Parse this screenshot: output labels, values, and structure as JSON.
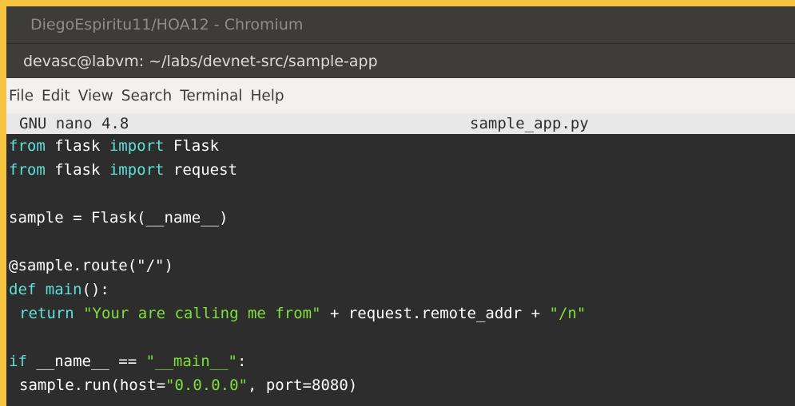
{
  "browser": {
    "title": "DiegoEspiritu11/HOA12 - Chromium"
  },
  "window": {
    "title": "devasc@labvm: ~/labs/devnet-src/sample-app"
  },
  "menu": {
    "items": [
      "File",
      "Edit",
      "View",
      "Search",
      "Terminal",
      "Help"
    ]
  },
  "nano": {
    "version": "GNU nano 4.8",
    "filename": "sample_app.py"
  },
  "code": {
    "l1": {
      "a": "from",
      "b": " flask ",
      "c": "import",
      "d": " Flask"
    },
    "l2": {
      "a": "from",
      "b": " flask ",
      "c": "import",
      "d": " request"
    },
    "l4": "sample = Flask(__name__)",
    "l6": "@sample.route(\"/\")",
    "l7": {
      "a": "def",
      "b": " ",
      "c": "main",
      "d": "():"
    },
    "l8": {
      "a": "return",
      "b": " ",
      "c": "\"Your are calling me from\"",
      "d": " + request.remote_addr + ",
      "e": "\"/n\""
    },
    "l10": {
      "a": "if",
      "b": " __name__ == ",
      "c": "\"__main__\"",
      "d": ":"
    },
    "l11": {
      "a": "sample.run(host=",
      "b": "\"0.0.0.0\"",
      "c": ", port=8080)"
    }
  },
  "colors": {
    "keyword": "#5de0d8",
    "string": "#7ee03a",
    "terminal_bg": "#2d2d2d"
  }
}
